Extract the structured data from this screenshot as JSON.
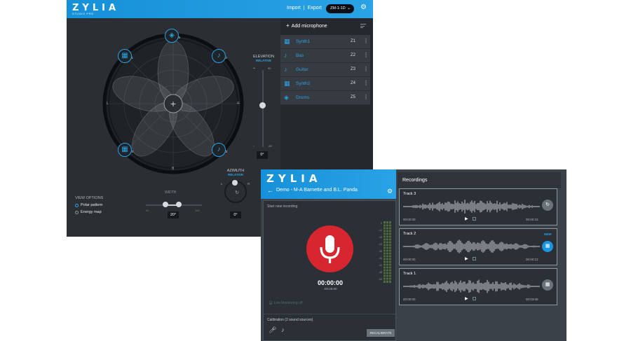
{
  "studio": {
    "logo": "ZYLIA",
    "logo_sub": "STUDIO PRO",
    "header": {
      "import": "Import",
      "sep": "|",
      "export": "Export",
      "device": "ZM-1-1D"
    },
    "circle": {
      "L": "L",
      "R": "R",
      "B": "B"
    },
    "source_numbers": [
      "1",
      "2",
      "3",
      "4",
      "5"
    ],
    "elevation": {
      "title": "ELEVATION",
      "subtitle": "RELATIVE",
      "top": "+",
      "top_value": "90",
      "bottom": "-",
      "bottom_value": "-90",
      "value": "0°"
    },
    "view_options": {
      "title": "VIEW OPTIONS",
      "items": [
        "Polar pattern",
        "Energy map"
      ],
      "selected": "Polar pattern"
    },
    "width": {
      "title": "WIDTH",
      "min": "90",
      "max": "180",
      "value": "20°"
    },
    "azimuth": {
      "title": "AZIMUTH",
      "subtitle": "RELATIVE",
      "left": "L",
      "right": "R",
      "value": "0°"
    },
    "mic_panel": {
      "add_label": "Add microphone",
      "microphones": [
        {
          "name": "Synth1",
          "zone": "Z1",
          "icon": "keyboard-icon"
        },
        {
          "name": "Bas",
          "zone": "Z2",
          "icon": "guitar-icon"
        },
        {
          "name": "Guitar",
          "zone": "Z3",
          "icon": "guitar-icon"
        },
        {
          "name": "Synth2",
          "zone": "Z4",
          "icon": "keyboard-icon"
        },
        {
          "name": "Drums",
          "zone": "Z5",
          "icon": "drum-icon"
        }
      ]
    }
  },
  "recorder": {
    "logo": "ZYLIA",
    "project_title": "Demo - M-A Barnette and B.L. Panda",
    "start_new": "Start new recording",
    "timer": "00:00:00",
    "timer_sub": "-00:25:00",
    "live_monitoring": "Live Monitoring off",
    "calibration": "Calibration (2 sound sources)",
    "recalibrate": "RECALIBRATE",
    "meter_labels": [
      "0",
      "-12",
      "-18",
      "-24",
      "-30",
      "-36",
      "-42",
      "-48",
      "-54"
    ],
    "recordings_title": "Recordings",
    "tracks": [
      {
        "name": "Track 3",
        "start": "00:00:00",
        "end": "00:00:15",
        "badge": "",
        "action": "sync-icon"
      },
      {
        "name": "Track 2",
        "start": "00:00:00",
        "end": "00:00:12",
        "badge": "NEW",
        "action": "process-icon"
      },
      {
        "name": "Track 1",
        "start": "00:00:00",
        "end": "00:03:09",
        "badge": "",
        "action": "process-icon"
      }
    ]
  },
  "colors": {
    "accent": "#2aa2e6",
    "record": "#d7262f",
    "studio_bg": "#2b2f33",
    "recorder_bg": "#3a4148"
  }
}
